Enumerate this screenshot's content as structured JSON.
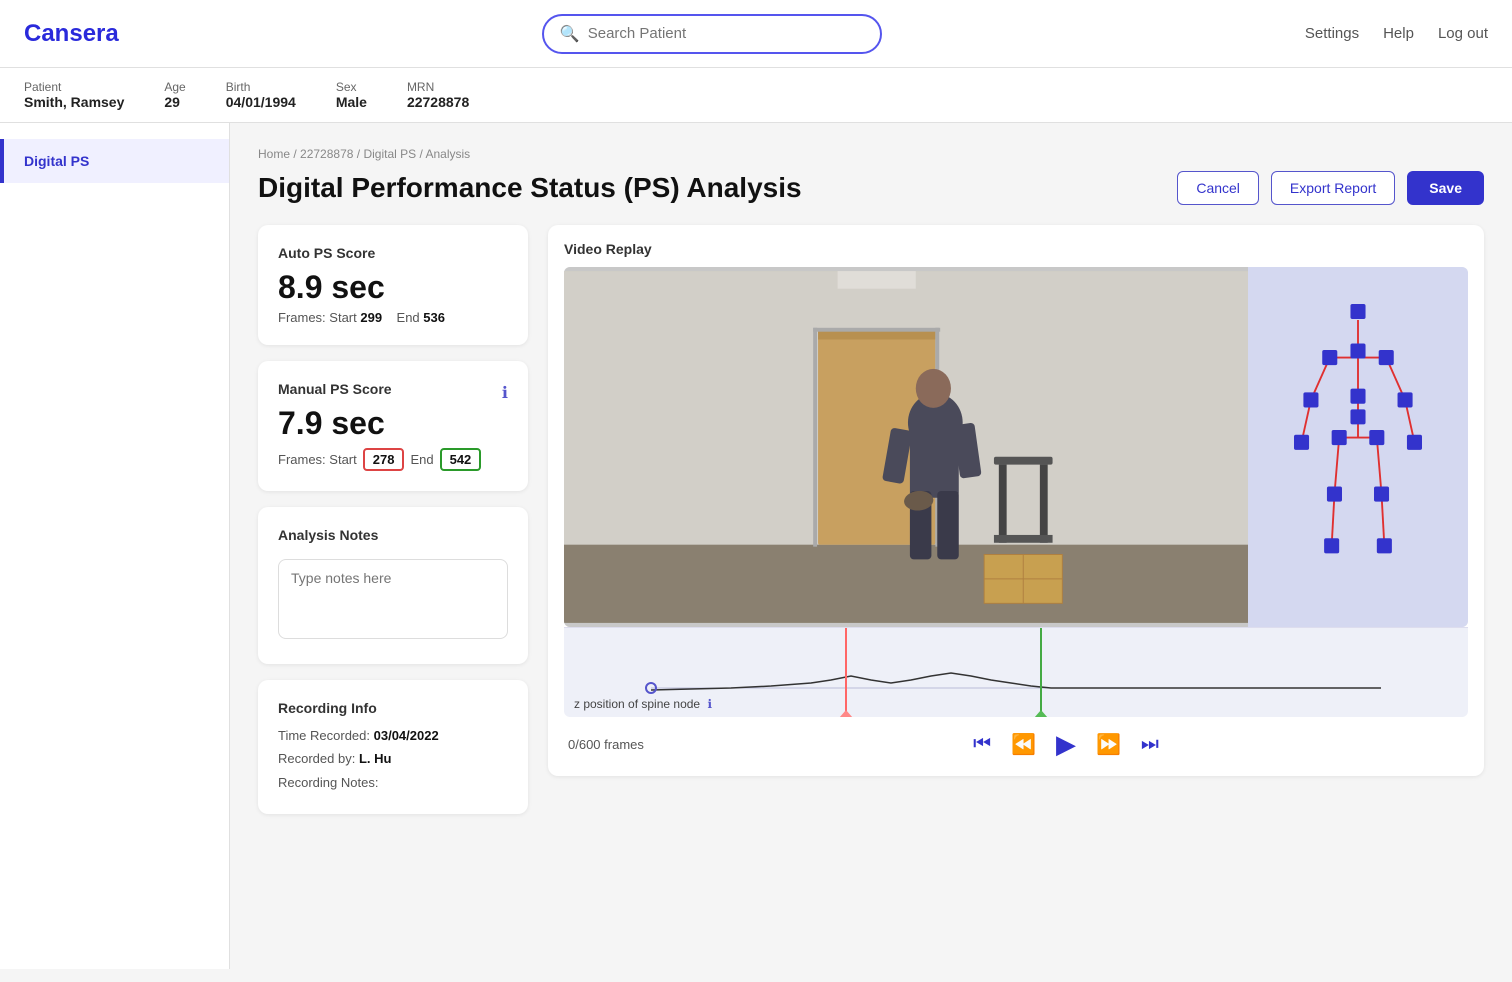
{
  "app": {
    "name": "Cansera"
  },
  "header": {
    "search_placeholder": "Search Patient",
    "nav": {
      "settings": "Settings",
      "help": "Help",
      "logout": "Log out"
    }
  },
  "patient": {
    "label": "Patient",
    "name": "Smith, Ramsey",
    "age_label": "Age",
    "age": "29",
    "birth_label": "Birth",
    "birth": "04/01/1994",
    "sex_label": "Sex",
    "sex": "Male",
    "mrn_label": "MRN",
    "mrn": "22728878"
  },
  "sidebar": {
    "items": [
      {
        "label": "Digital PS",
        "active": true
      }
    ]
  },
  "breadcrumb": {
    "home": "Home",
    "mrn": "22728878",
    "section": "Digital PS",
    "page": "Analysis"
  },
  "page": {
    "title": "Digital Performance Status (PS) Analysis",
    "cancel_label": "Cancel",
    "export_label": "Export Report",
    "save_label": "Save"
  },
  "auto_ps": {
    "title": "Auto PS Score",
    "score": "8.9 sec",
    "frames_prefix": "Frames: Start",
    "start": "299",
    "end_label": "End",
    "end": "536"
  },
  "manual_ps": {
    "title": "Manual PS Score",
    "score": "7.9 sec",
    "frames_prefix": "Frames: Start",
    "start": "278",
    "end_label": "End",
    "end": "542"
  },
  "notes": {
    "title": "Analysis Notes",
    "placeholder": "Type notes here"
  },
  "recording": {
    "title": "Recording Info",
    "time_label": "Time Recorded:",
    "time_value": "03/04/2022",
    "by_label": "Recorded by:",
    "by_value": "L. Hu",
    "notes_label": "Recording Notes:"
  },
  "video": {
    "title": "Video Replay",
    "frames_counter": "0/600 frames",
    "chart_label": "z position of spine node"
  },
  "controls": {
    "first": "⏮",
    "rewind": "⏪",
    "play": "▶",
    "forward": "⏩",
    "last": "⏭"
  }
}
